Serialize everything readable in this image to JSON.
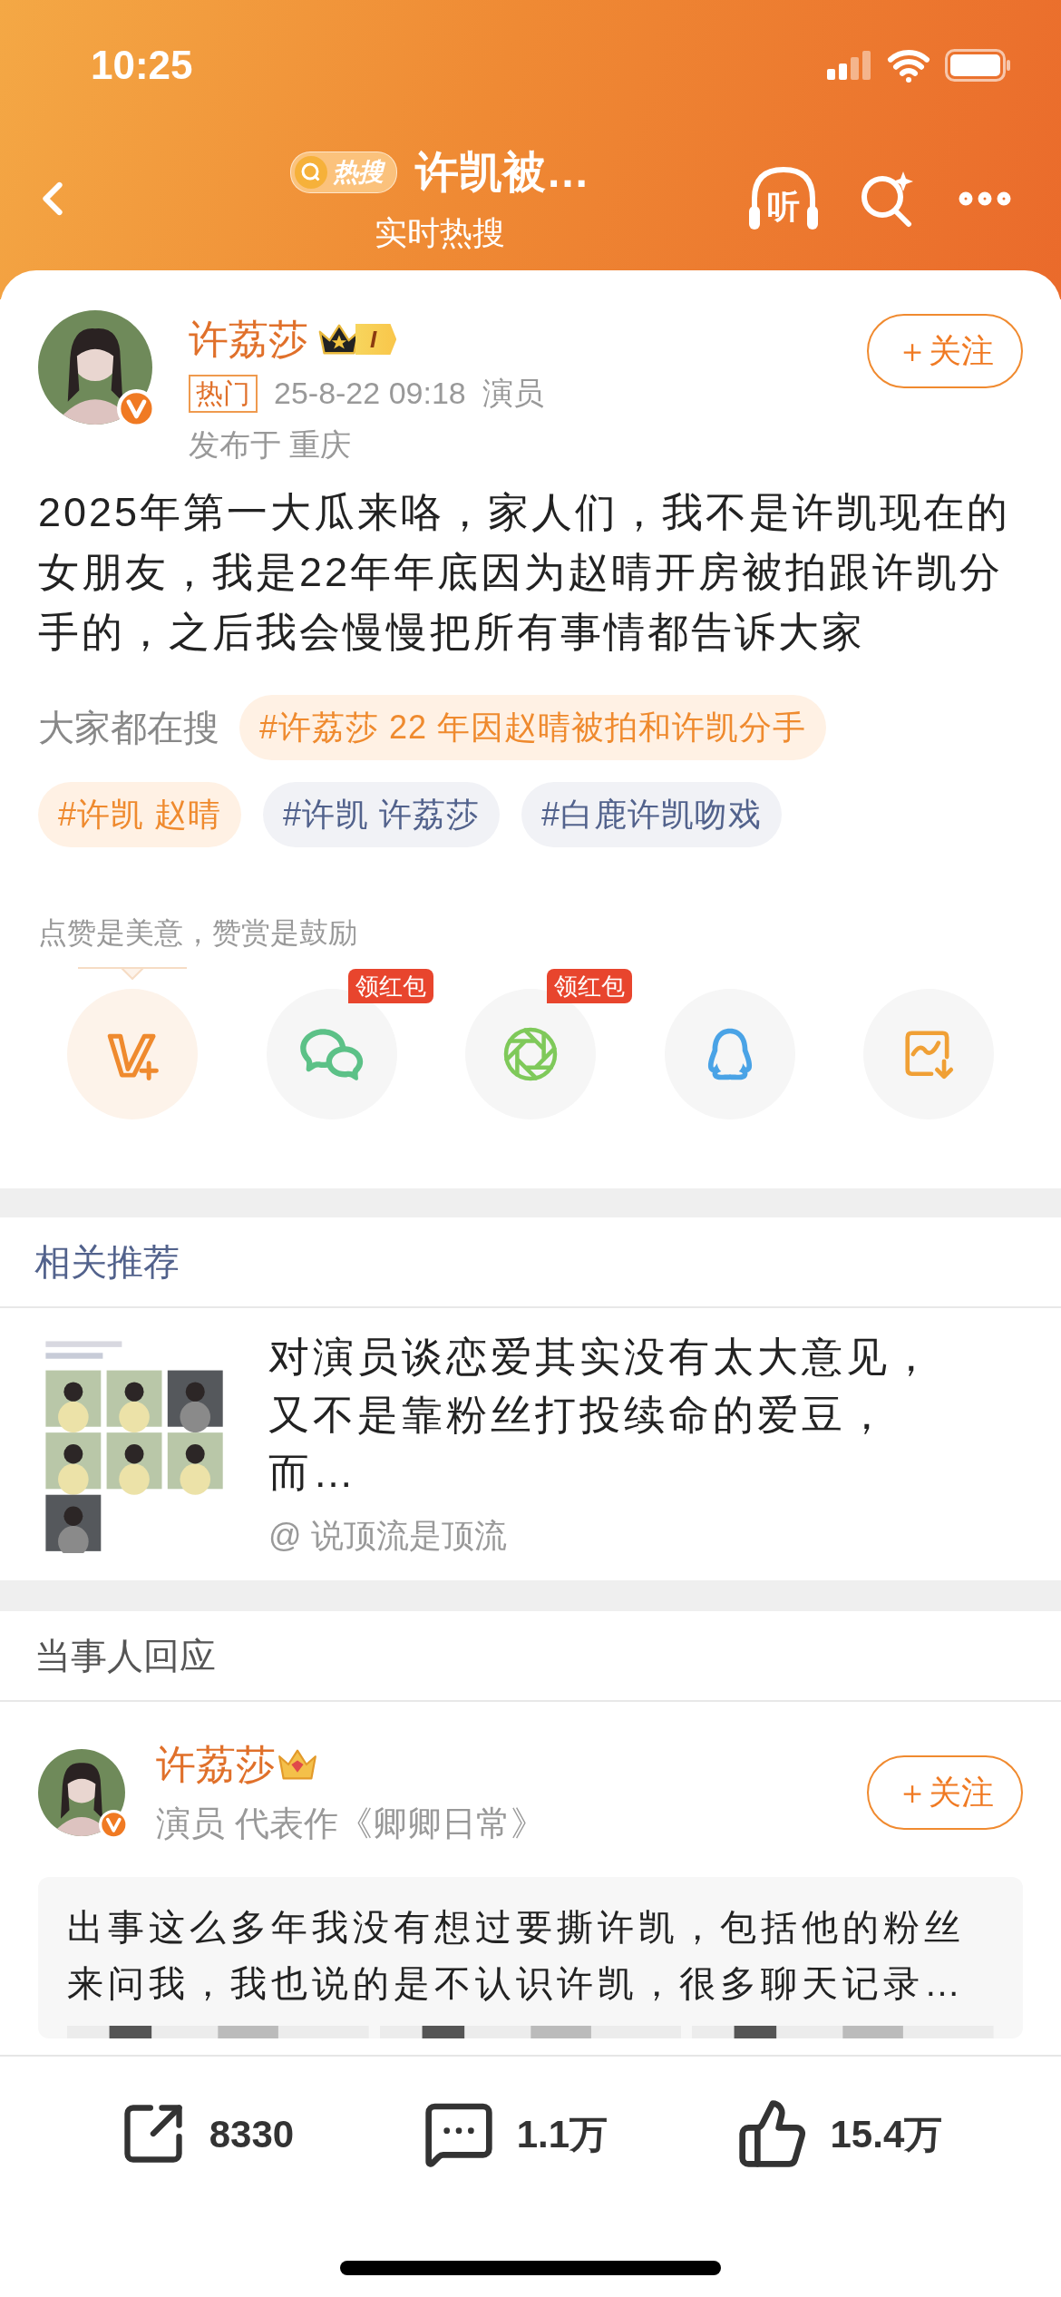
{
  "status_bar": {
    "time": "10:25"
  },
  "nav": {
    "badge": "热搜",
    "title": "许凯被…",
    "subtitle": "实时热搜",
    "listen_label": "听"
  },
  "post": {
    "author": "许荔莎",
    "level_badge": "I",
    "hot_tag": "热门",
    "time": "25-8-22 09:18",
    "source": "演员",
    "location": "发布于 重庆",
    "follow": "＋关注",
    "body": "2025年第一大瓜来咯，家人们，我不是许凯现在的女朋友，我是22年年底因为赵晴开房被拍跟许凯分手的，之后我会慢慢把所有事情都告诉大家"
  },
  "searching": {
    "label": "大家都在搜",
    "tags": [
      {
        "text": "#许荔莎 22 年因赵晴被拍和许凯分手",
        "kind": "hot"
      },
      {
        "text": "#许凯 赵晴",
        "kind": "hot"
      },
      {
        "text": "#许凯 许荔莎",
        "kind": "plain"
      },
      {
        "text": "#白鹿许凯吻戏",
        "kind": "plain"
      }
    ]
  },
  "reward": {
    "caption": "点赞是美意，赞赏是鼓励"
  },
  "share": [
    {
      "kind": "vplus",
      "selected": true
    },
    {
      "kind": "wechat",
      "selected": false,
      "badge": "领红包"
    },
    {
      "kind": "moments",
      "selected": false,
      "badge": "领红包"
    },
    {
      "kind": "qq",
      "selected": false
    },
    {
      "kind": "save_image",
      "selected": false
    }
  ],
  "related": {
    "heading": "相关推荐",
    "items": [
      {
        "title": "对演员谈恋爱其实没有太大意见，又不是靠粉丝打投续命的爱豆，而…",
        "author": "@ 说顶流是顶流"
      }
    ]
  },
  "response": {
    "heading": "当事人回应",
    "author": "许荔莎",
    "bio": "演员 代表作《卿卿日常》",
    "follow": "＋关注",
    "quote": "出事这么多年我没有想过要撕许凯，包括他的粉丝来问我，我也说的是不认识许凯，很多聊天记录…"
  },
  "actions": [
    {
      "kind": "repost",
      "count": "8330"
    },
    {
      "kind": "comment",
      "count": "1.1万"
    },
    {
      "kind": "like",
      "count": "15.4万"
    }
  ]
}
